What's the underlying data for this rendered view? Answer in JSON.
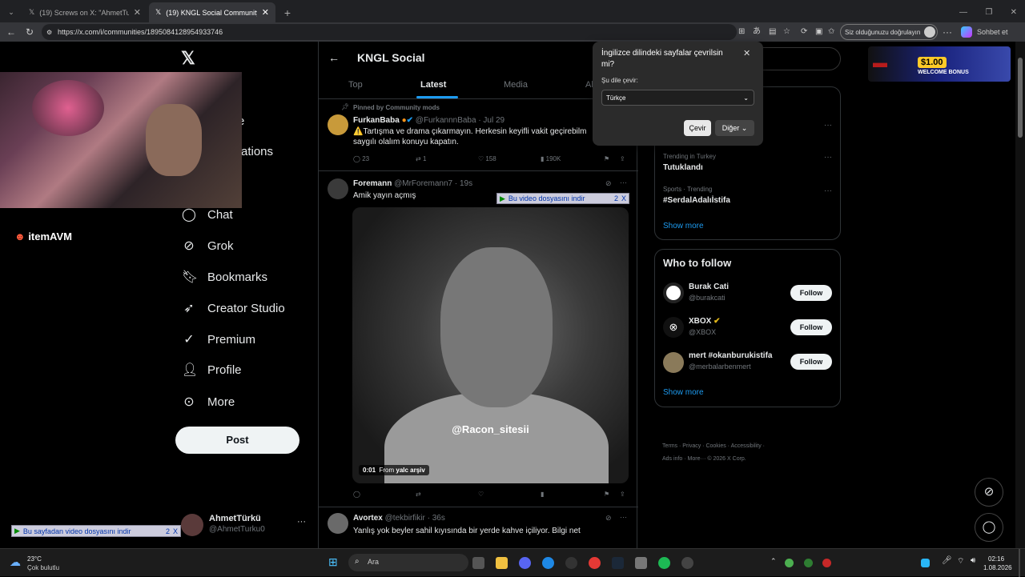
{
  "browser": {
    "tabs": [
      {
        "label": "(19) Screws on X: \"AhmetTurku Bu...",
        "active": false
      },
      {
        "label": "(19) KNGL Social Community / X",
        "active": true
      }
    ],
    "url": "https://x.com/i/communities/1895084128954933746",
    "signin_label": "Siz olduğunuzu doğrulayın",
    "copilot_label": "Sohbet et"
  },
  "nav": {
    "items": [
      {
        "label": "ations"
      },
      {
        "label": "Chat"
      },
      {
        "label": "Grok"
      },
      {
        "label": "Bookmarks"
      },
      {
        "label": "Creator Studio"
      },
      {
        "label": "Premium"
      },
      {
        "label": "Profile"
      },
      {
        "label": "More"
      }
    ],
    "post_label": "Post",
    "user_name": "AhmetTürkü",
    "user_handle": "@AhmetTurku0",
    "partial_e": "e"
  },
  "ads": {
    "itemavm": "itemAVM",
    "casino_amount": "$1.00",
    "casino_text": "WELCOME BONUS"
  },
  "download_bars": {
    "top": "Bu video dosyasını indir",
    "bottom": "Bu sayfadan video dosyasını indir",
    "count": "2",
    "x": "X"
  },
  "community": {
    "title": "KNGL Social",
    "tabs": [
      "Top",
      "Latest",
      "Media",
      "Al"
    ],
    "tweets": [
      {
        "pinned_label": "Pinned by Community mods",
        "name": "FurkanBaba",
        "handle": "@FurkannnBaba · Jul 29",
        "text": "⚠️Tartışma ve drama çıkarmayın. Herkesin keyifli vakit geçirebilm",
        "text2": "saygılı olalım konuyu kapatın.",
        "replies": "23",
        "reposts": "1",
        "likes": "158",
        "views": "190K"
      },
      {
        "name": "Foremann",
        "handle": "@MrForemann7 · 19s",
        "text": "Amik yayın açmış",
        "watermark": "@Racon_sitesii",
        "video_time": "0:01",
        "video_from": "From",
        "video_source": "yalc arşiv"
      },
      {
        "name": "Avortex",
        "handle": "@tekbirfikir · 36s",
        "text": "Yanlış yok beyler sahil kıyısında bir yerde kahve içiliyor. Bilgi net"
      }
    ]
  },
  "translate_popup": {
    "question": "İngilizce dilindeki sayfalar çevrilsin mi?",
    "target_label": "Şu dile çevir:",
    "selected_language": "Türkçe",
    "translate_button": "Çevir",
    "other_button": "Diğer"
  },
  "trends": [
    {
      "sub": "Trending in Turkey",
      "main": "Tutuklandı"
    },
    {
      "sub": "Sports · Trending",
      "main": "#SerdalAdalıİstifa"
    }
  ],
  "trends_show_more": "Show more",
  "who_to_follow": {
    "title": "Who to follow",
    "users": [
      {
        "name": "Burak Cati",
        "handle": "@burakcati"
      },
      {
        "name": "XBOX",
        "handle": "@XBOX"
      },
      {
        "name": "mert #okanburukistifa",
        "handle": "@merbalarbenmert"
      }
    ],
    "follow_label": "Follow",
    "show_more": "Show more"
  },
  "footer": {
    "line1": "Terms · Privacy · Cookies · Accessibility ·",
    "line2": "Ads info · More··· © 2026 X Corp."
  },
  "taskbar": {
    "weather_temp": "23°C",
    "weather_desc": "Çok bulutlu",
    "search": "Ara",
    "time": "02:16",
    "date": "1.08.2026"
  },
  "colors": {
    "accent": "#1d9bf0",
    "background": "#000000",
    "border": "#2f3336"
  }
}
